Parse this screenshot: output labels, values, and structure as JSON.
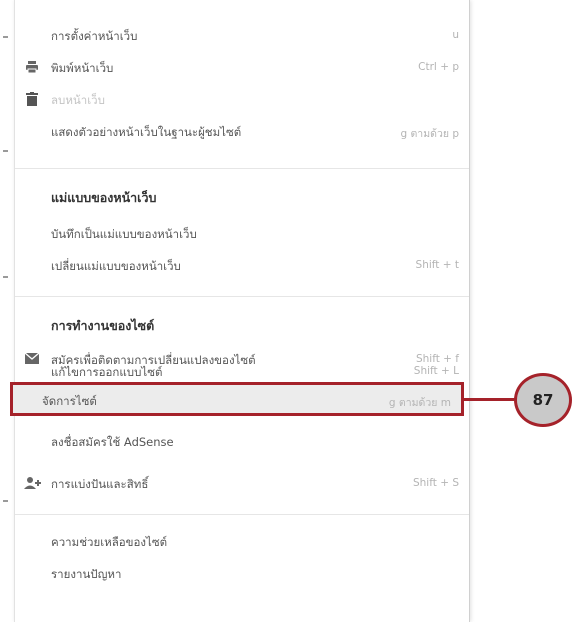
{
  "menu": {
    "section1": {
      "items": [
        {
          "label": "การตั้งค่าหน้าเว็บ",
          "shortcut": "u",
          "icon": "",
          "disabled": false
        },
        {
          "label": "พิมพ์หน้าเว็บ",
          "shortcut": "Ctrl + p",
          "icon": "printer-icon",
          "disabled": false
        },
        {
          "label": "ลบหน้าเว็บ",
          "shortcut": "",
          "icon": "trash-icon",
          "disabled": true
        },
        {
          "label": "แสดงตัวอย่างหน้าเว็บในฐานะผู้ชมไซต์",
          "shortcut": "g ตามด้วย p",
          "icon": "",
          "disabled": false
        }
      ]
    },
    "section2": {
      "header": "แม่แบบของหน้าเว็บ",
      "items": [
        {
          "label": "บันทึกเป็นแม่แบบของหน้าเว็บ",
          "shortcut": ""
        },
        {
          "label": "เปลี่ยนแม่แบบของหน้าเว็บ",
          "shortcut": "Shift + t"
        }
      ]
    },
    "section3": {
      "header": "การทำงานของไซต์",
      "items": [
        {
          "label": "สมัครเพื่อติดตามการเปลี่ยนแปลงของไซต์",
          "shortcut": "Shift + f",
          "icon": "mail-icon"
        },
        {
          "label": "แก้ไขการออกแบบไซต์",
          "shortcut": "Shift + L",
          "icon": ""
        },
        {
          "label": "จัดการไซต์",
          "shortcut": "g ตามด้วย m",
          "icon": ""
        },
        {
          "label": "ลงชื่อสมัครใช้ AdSense",
          "shortcut": "",
          "icon": ""
        },
        {
          "label": "การแบ่งปันและสิทธิ์",
          "shortcut": "Shift + S",
          "icon": "add-person-icon"
        }
      ]
    },
    "section4": {
      "items": [
        {
          "label": "ความช่วยเหลือของไซต์",
          "shortcut": ""
        },
        {
          "label": "รายงานปัญหา",
          "shortcut": ""
        }
      ]
    }
  },
  "callout": {
    "number": "87",
    "highlight_color": "#a5222a",
    "badge_color": "#c9c9c9"
  }
}
